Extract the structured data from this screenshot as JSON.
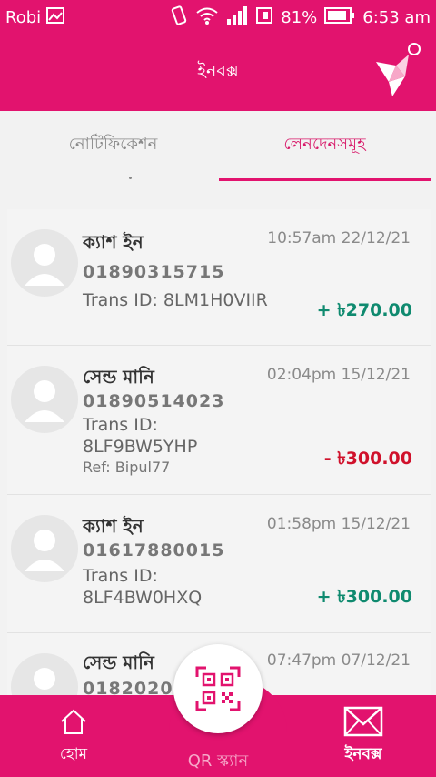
{
  "status_bar": {
    "carrier": "Robi",
    "battery": "81%",
    "time": "6:53 am"
  },
  "header": {
    "title": "ইনবক্স"
  },
  "tabs": [
    {
      "label": "নোটিফিকেশন",
      "active": false
    },
    {
      "label": "লেনদেনসমূহ",
      "active": true
    }
  ],
  "transactions": [
    {
      "title": "ক্যাশ ইন",
      "time": "10:57am 22/12/21",
      "phone": "01890315715",
      "trans_id_line1": "Trans ID: 8LM1H0VIIR",
      "trans_id_line2": "",
      "ref": "",
      "amount": "+ ৳270.00",
      "type": "credit"
    },
    {
      "title": "সেন্ড মানি",
      "time": "02:04pm 15/12/21",
      "phone": "01890514023",
      "trans_id_line1": "Trans ID:",
      "trans_id_line2": "8LF9BW5YHP",
      "ref": "Ref: Bipul77",
      "amount": "- ৳300.00",
      "type": "debit"
    },
    {
      "title": "ক্যাশ ইন",
      "time": "01:58pm 15/12/21",
      "phone": "01617880015",
      "trans_id_line1": "Trans ID:",
      "trans_id_line2": "8LF4BW0HXQ",
      "ref": "",
      "amount": "+ ৳300.00",
      "type": "credit"
    },
    {
      "title": "সেন্ড মানি",
      "time": "07:47pm 07/12/21",
      "phone": "018202054",
      "trans_id_line1": "",
      "trans_id_line2": "",
      "ref": "",
      "amount": "",
      "type": "debit"
    }
  ],
  "bottom_nav": {
    "home_label": "হোম",
    "qr_label": "QR স্ক্যান",
    "inbox_label": "ইনবক্স"
  },
  "colors": {
    "brand": "#e2136e",
    "credit": "#0f8a6f",
    "debit": "#d0112b"
  },
  "icons": [
    "signal-icon",
    "wifi-icon",
    "battery-icon",
    "bkash-bird-logo",
    "avatar-icon",
    "home-icon",
    "qr-icon",
    "mail-icon"
  ]
}
